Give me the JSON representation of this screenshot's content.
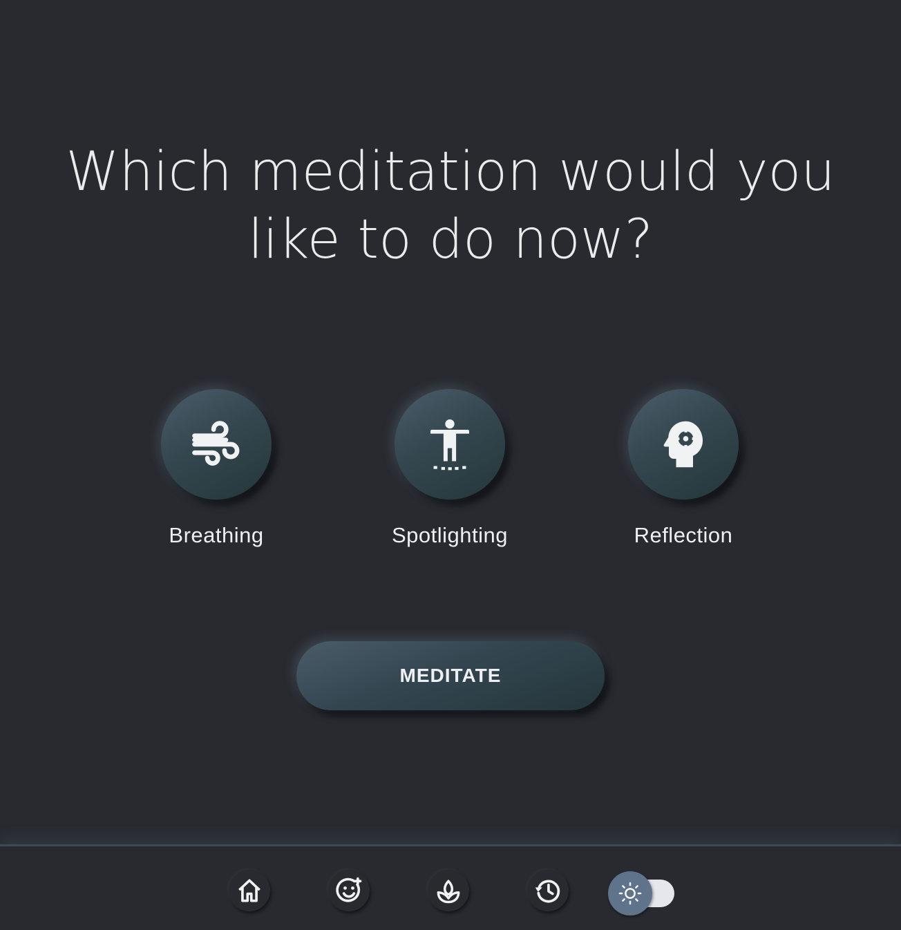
{
  "headline": {
    "line1": "Which meditation would you",
    "line2": "like to do now?"
  },
  "options": [
    {
      "label": "Breathing",
      "icon": "wind-icon"
    },
    {
      "label": "Spotlighting",
      "icon": "body-scan-icon"
    },
    {
      "label": "Reflection",
      "icon": "head-gear-icon"
    }
  ],
  "meditate_button": {
    "label": "MEDITATE"
  },
  "bottom_nav": {
    "items": [
      {
        "icon": "home-icon"
      },
      {
        "icon": "mood-icon"
      },
      {
        "icon": "lotus-icon"
      },
      {
        "icon": "history-icon"
      }
    ],
    "theme_toggle": {
      "icon": "sun-icon",
      "state": "dark"
    }
  },
  "colors": {
    "background": "#282a30",
    "button_gradient_start": "#4b5c69",
    "button_gradient_end": "#24373a",
    "text": "#eef0f3",
    "toggle_thumb": "#5f748b",
    "toggle_track": "#e6e7ec"
  }
}
